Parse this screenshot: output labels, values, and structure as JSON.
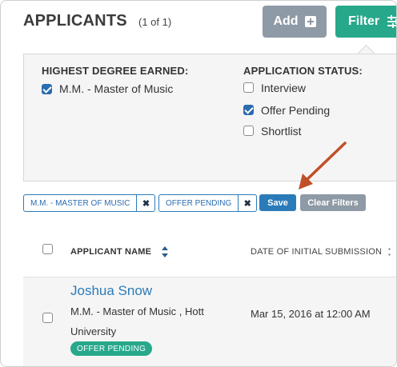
{
  "header": {
    "title": "APPLICANTS",
    "count": "(1 of 1)",
    "add_label": "Add",
    "filter_label": "Filter"
  },
  "filters": {
    "degree": {
      "heading": "HIGHEST DEGREE EARNED:",
      "options": [
        {
          "label": "M.M. - Master of Music",
          "checked": true
        }
      ]
    },
    "status": {
      "heading": "APPLICATION STATUS:",
      "options": [
        {
          "label": "Interview",
          "checked": false
        },
        {
          "label": "Offer Pending",
          "checked": true
        },
        {
          "label": "Shortlist",
          "checked": false
        }
      ]
    }
  },
  "chips": [
    {
      "label": "M.M. - MASTER OF MUSIC",
      "remove": "✖"
    },
    {
      "label": "OFFER PENDING",
      "remove": "✖"
    }
  ],
  "actions": {
    "save_label": "Save",
    "clear_label": "Clear Filters"
  },
  "table": {
    "columns": [
      "APPLICANT NAME",
      "DATE OF INITIAL SUBMISSION"
    ],
    "rows": [
      {
        "name": "Joshua Snow",
        "description": "M.M. - Master of Music , Hott University",
        "date": "Mar 15, 2016 at 12:00 AM",
        "status": "OFFER PENDING"
      }
    ]
  },
  "colors": {
    "accent_green": "#27a88b",
    "primary_blue": "#2b7bb9",
    "gray_button": "#8e9aa6",
    "annotation_arrow": "#c0502a"
  },
  "icons": {
    "add": "plus-box-icon",
    "filter": "sliders-icon",
    "sort": "sort-updown-icon",
    "remove": "close-icon"
  }
}
